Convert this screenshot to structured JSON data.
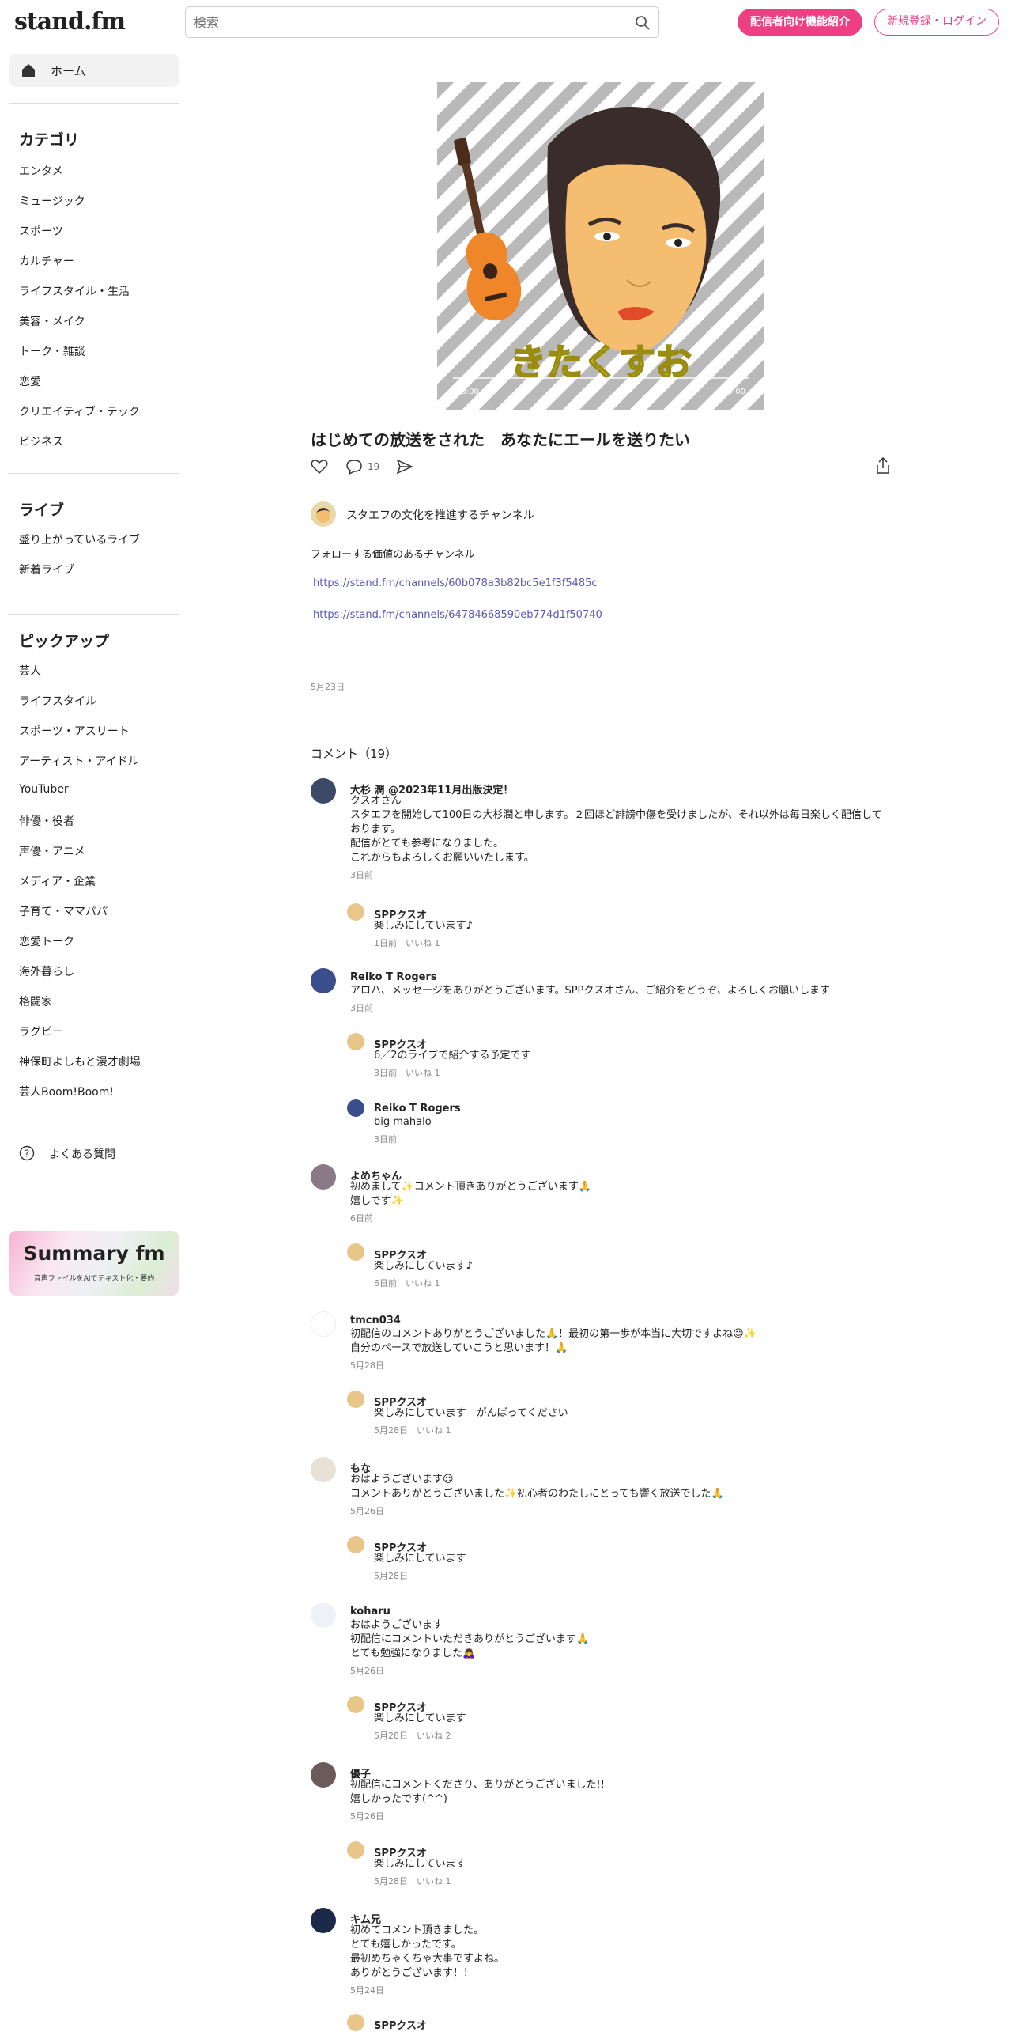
{
  "header": {
    "logo": "stand.fm",
    "search_placeholder": "検索",
    "creator_button": "配信者向け機能紹介",
    "login_button": "新規登録・ログイン"
  },
  "sidebar": {
    "home": "ホーム",
    "category_heading": "カテゴリ",
    "categories": [
      "エンタメ",
      "ミュージック",
      "スポーツ",
      "カルチャー",
      "ライフスタイル・生活",
      "美容・メイク",
      "トーク・雑談",
      "恋愛",
      "クリエイティブ・テック",
      "ビジネス"
    ],
    "live_heading": "ライブ",
    "live": [
      "盛り上がっているライブ",
      "新着ライブ"
    ],
    "pickup_heading": "ピックアップ",
    "pickup": [
      "芸人",
      "ライフスタイル",
      "スポーツ・アスリート",
      "アーティスト・アイドル",
      "YouTuber",
      "俳優・役者",
      "声優・アニメ",
      "メディア・企業",
      "子育て・ママパパ",
      "恋愛トーク",
      "海外暮らし",
      "格闘家",
      "ラグビー",
      "神保町よしもと漫才劇場",
      "芸人Boom!Boom!"
    ],
    "faq": "よくある質問",
    "banner_title": "Summary fm",
    "banner_sub": "音声ファイルをAIでテキスト化・要約"
  },
  "episode": {
    "cover_text": "きたくすお",
    "time_start": "00:00",
    "time_end": "00:00",
    "title": "はじめての放送をされた　あなたにエールを送りたい",
    "comment_count": "19",
    "channel_name": "スタエフの文化を推進するチャンネル",
    "description": "フォローする価値のあるチャンネル",
    "link1": "https://stand.fm/channels/60b078a3b82bc5e1f3f5485c",
    "link2": "https://stand.fm/channels/64784668590eb774d1f50740",
    "date": "5月23日"
  },
  "comments_heading": "コメント（19）",
  "comments": [
    {
      "name": "大杉 潤 @2023年11月出版決定！",
      "lines": [
        "クスオさん",
        "スタエフを開始して100日の大杉潤と申します。２回ほど誹謗中傷を受けましたが、それ以外は毎日楽しく配信して",
        "おります。",
        "配信がとても参考になりました。",
        "これからもよろしくお願いいたします。"
      ],
      "meta": "3日前"
    },
    {
      "name": "SPPクスオ",
      "lines": [
        "楽しみにしています♪"
      ],
      "meta": "1日前　いいね 1"
    },
    {
      "name": "Reiko T Rogers",
      "lines": [
        "アロハ、メッセージをありがとうございます。SPPクスオさん、ご紹介をどうぞ、よろしくお願いします"
      ],
      "meta": "3日前"
    },
    {
      "name": "SPPクスオ",
      "lines": [
        "6／2のライブで紹介する予定です"
      ],
      "meta": "3日前　いいね 1"
    },
    {
      "name": "Reiko T Rogers",
      "lines": [
        "big mahalo"
      ],
      "meta": "3日前"
    },
    {
      "name": "よめちゃん",
      "lines": [
        "初めまして✨コメント頂きありがとうございます🙏",
        "嬉しです✨"
      ],
      "meta": "6日前"
    },
    {
      "name": "SPPクスオ",
      "lines": [
        "楽しみにしています♪"
      ],
      "meta": "6日前　いいね 1"
    },
    {
      "name": "tmcn034",
      "lines": [
        "初配信のコメントありがとうございました🙏！最初の第一歩が本当に大切ですよね☺✨",
        "自分のペースで放送していこうと思います！🙏"
      ],
      "meta": "5月28日"
    },
    {
      "name": "SPPクスオ",
      "lines": [
        "楽しみにしています　がんばってください"
      ],
      "meta": "5月28日　いいね 1"
    },
    {
      "name": "もな",
      "lines": [
        "おはようございます☺",
        "コメントありがとうございました✨初心者のわたしにとっても響く放送でした🙏"
      ],
      "meta": "5月26日"
    },
    {
      "name": "SPPクスオ",
      "lines": [
        "楽しみにしています"
      ],
      "meta": "5月28日"
    },
    {
      "name": "koharu",
      "lines": [
        "おはようございます",
        "初配信にコメントいただきありがとうございます🙏",
        "とても勉強になりました🙇‍♀"
      ],
      "meta": "5月26日"
    },
    {
      "name": "SPPクスオ",
      "lines": [
        "楽しみにしています"
      ],
      "meta": "5月28日　いいね 2"
    },
    {
      "name": "優子",
      "lines": [
        "初配信にコメントくださり、ありがとうございました!!",
        "嬉しかったです(^^)"
      ],
      "meta": "5月26日"
    },
    {
      "name": "SPPクスオ",
      "lines": [
        "楽しみにしています"
      ],
      "meta": "5月28日　いいね 1"
    },
    {
      "name": "キム兄",
      "lines": [
        "初めてコメント頂きました。",
        "とても嬉しかったです。",
        "最初めちゃくちゃ大事ですよね。",
        "ありがとうございます！！"
      ],
      "meta": "5月24日"
    },
    {
      "name": "SPPクスオ",
      "lines": [],
      "meta": ""
    }
  ],
  "colors": {
    "accent": "#ef3f83",
    "link": "#5a56b8"
  }
}
